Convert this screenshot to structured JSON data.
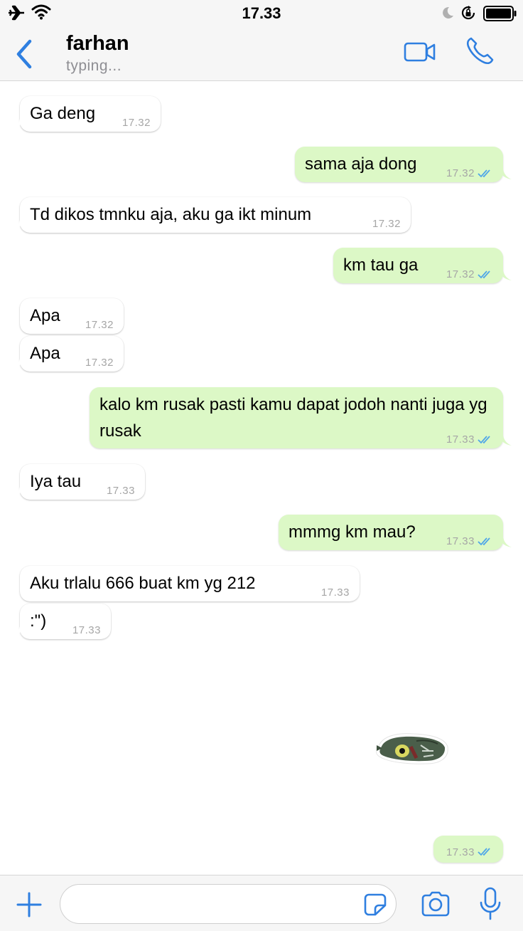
{
  "status_bar": {
    "time": "17.33"
  },
  "header": {
    "contact_name": "farhan",
    "status": "typing..."
  },
  "messages": [
    {
      "dir": "in",
      "text": "Ga deng",
      "time": "17.32"
    },
    {
      "dir": "out",
      "text": "sama aja dong",
      "time": "17.32",
      "read": true
    },
    {
      "dir": "in",
      "text": "Td dikos tmnku aja, aku ga ikt minum",
      "time": "17.32"
    },
    {
      "dir": "out",
      "text": "km tau ga",
      "time": "17.32",
      "read": true
    },
    {
      "dir": "in",
      "text": "Apa",
      "time": "17.32"
    },
    {
      "dir": "in",
      "text": "Apa",
      "time": "17.32"
    },
    {
      "dir": "out",
      "text": "kalo km rusak pasti kamu dapat jodoh nanti juga yg rusak",
      "time": "17.33",
      "read": true
    },
    {
      "dir": "in",
      "text": "Iya tau",
      "time": "17.33"
    },
    {
      "dir": "out",
      "text": "mmmg km mau?",
      "time": "17.33",
      "read": true
    },
    {
      "dir": "in",
      "text": "Aku trlalu 666 buat km yg 212",
      "time": "17.33"
    },
    {
      "dir": "in",
      "text": ":\")",
      "time": "17.33"
    },
    {
      "dir": "out",
      "kind": "sticker",
      "sticker": "green-creature-sticker",
      "time": "17.33",
      "read": true
    }
  ],
  "input": {
    "placeholder": ""
  },
  "colors": {
    "accent": "#2f7fe0",
    "outgoing_bubble": "#dcf8c6",
    "incoming_bubble": "#ffffff",
    "read_tick": "#4fa6e8",
    "timestamp": "#a6a6a6"
  }
}
